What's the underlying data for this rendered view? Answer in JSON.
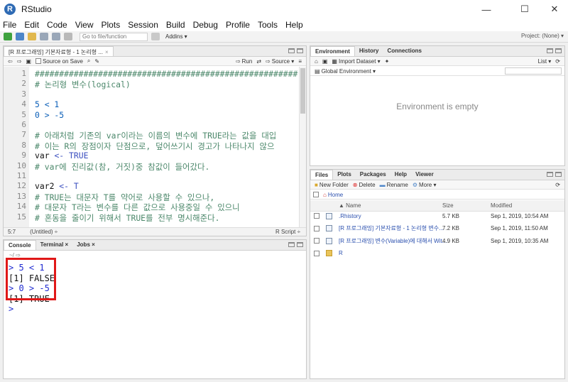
{
  "window": {
    "title": "RStudio",
    "minimize": "—",
    "maximize": "☐",
    "close": "✕"
  },
  "menu": [
    "File",
    "Edit",
    "Code",
    "View",
    "Plots",
    "Session",
    "Build",
    "Debug",
    "Profile",
    "Tools",
    "Help"
  ],
  "toolbar": {
    "goto_placeholder": "Go to file/function",
    "addins": "Addins ▾",
    "project": "Project: (None) ▾"
  },
  "editor": {
    "tab_label": "[R 프로그래밍] 기본자료형 - 1 논리형 ...",
    "source_on_save": "Source on Save",
    "run": "Run",
    "source": "Source ▾",
    "lines": [
      {
        "n": "1",
        "segments": [
          {
            "c": "cm",
            "t": "######################################################"
          }
        ]
      },
      {
        "n": "2",
        "segments": [
          {
            "c": "cm",
            "t": "# 논리형 변수(logical)"
          }
        ]
      },
      {
        "n": "3",
        "segments": []
      },
      {
        "n": "4",
        "segments": [
          {
            "c": "num",
            "t": "5 < 1"
          }
        ]
      },
      {
        "n": "5",
        "segments": [
          {
            "c": "num",
            "t": "0 > -5"
          }
        ]
      },
      {
        "n": "6",
        "segments": []
      },
      {
        "n": "7",
        "segments": [
          {
            "c": "cm",
            "t": "# 아래처럼 기존의 var이라는 이름의 변수에 TRUE라는 값을 대입"
          }
        ]
      },
      {
        "n": "8",
        "segments": [
          {
            "c": "cm",
            "t": "# 이는 R의 장점이자 단점으로, 덮어쓰기시 경고가 나타나지 않으"
          }
        ]
      },
      {
        "n": "9",
        "segments": [
          {
            "c": "plain",
            "t": "var "
          },
          {
            "c": "kw",
            "t": "<- TRUE"
          }
        ]
      },
      {
        "n": "10",
        "segments": [
          {
            "c": "cm",
            "t": "# var에 진리값(참, 거짓)중 참값이 들어갔다."
          }
        ]
      },
      {
        "n": "11",
        "segments": []
      },
      {
        "n": "12",
        "segments": [
          {
            "c": "plain",
            "t": "var2 "
          },
          {
            "c": "kw",
            "t": "<- T"
          }
        ]
      },
      {
        "n": "13",
        "segments": [
          {
            "c": "cm",
            "t": "# TRUE는 대문자 T를 약어로 사용할 수 있으나,"
          }
        ]
      },
      {
        "n": "14",
        "segments": [
          {
            "c": "cm",
            "t": "# 대문자 T라는 변수를 다른 값으로 사용중일 수 있으니"
          }
        ]
      },
      {
        "n": "15",
        "segments": [
          {
            "c": "cm",
            "t": "# 혼동을 줄이기 위해서 TRUE를 전부 명시해준다."
          }
        ]
      }
    ],
    "status_pos": "5:7",
    "status_scope": "(Untitled) ÷",
    "status_type": "R Script ÷"
  },
  "console": {
    "tabs": [
      "Console",
      "Terminal ×",
      "Jobs ×"
    ],
    "path": "~/ ⇨",
    "lines": [
      {
        "cls": "prompt",
        "t": "> 5 < 1"
      },
      {
        "cls": "out",
        "t": "[1] FALSE"
      },
      {
        "cls": "prompt",
        "t": "> 0 > -5"
      },
      {
        "cls": "out",
        "t": "[1] TRUE"
      },
      {
        "cls": "prompt",
        "t": ">"
      }
    ]
  },
  "environment": {
    "tabs": [
      "Environment",
      "History",
      "Connections"
    ],
    "import_dataset": "Import Dataset ▾",
    "list": "List ▾",
    "scope": "Global Environment ▾",
    "empty": "Environment is empty"
  },
  "files": {
    "tabs": [
      "Files",
      "Plots",
      "Packages",
      "Help",
      "Viewer"
    ],
    "new_folder": "New Folder",
    "delete": "Delete",
    "rename": "Rename",
    "more": "More ▾",
    "home": "Home",
    "headers": {
      "name": "▲ Name",
      "size": "Size",
      "modified": "Modified"
    },
    "rows": [
      {
        "name": ".Rhistory",
        "size": "5.7 KB",
        "modified": "Sep 1, 2019, 10:54 AM",
        "folder": false
      },
      {
        "name": "[R 프로그래밍] 기본자료형 - 1 논리형 변수...",
        "size": "7.2 KB",
        "modified": "Sep 1, 2019, 11:50 AM",
        "folder": false
      },
      {
        "name": "[R 프로그래밍] 변수(Variable)에 대해서 Wit...",
        "size": "4.9 KB",
        "modified": "Sep 1, 2019, 10:35 AM",
        "folder": false
      },
      {
        "name": "R",
        "size": "",
        "modified": "",
        "folder": true
      }
    ]
  }
}
